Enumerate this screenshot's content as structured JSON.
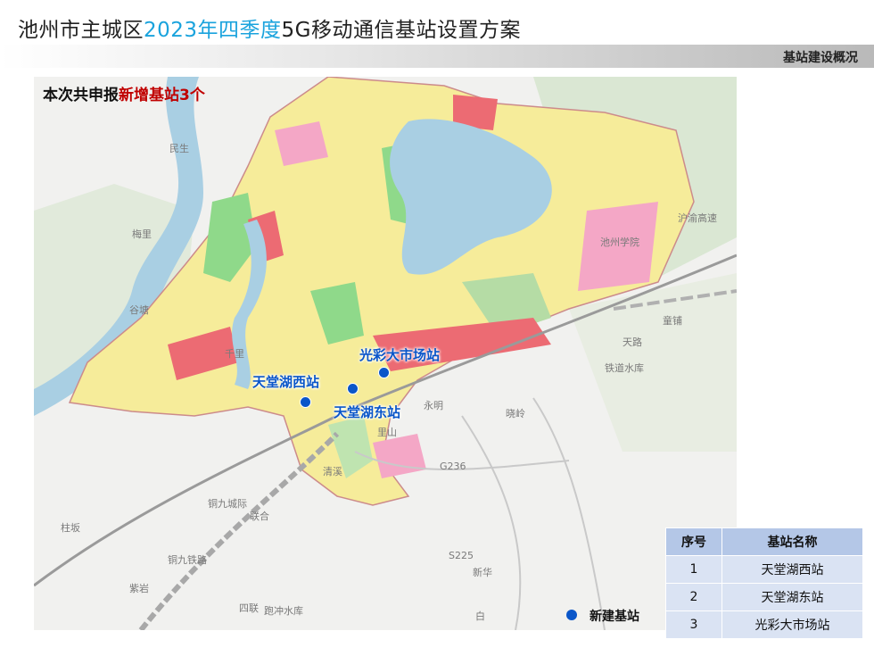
{
  "header": {
    "title_prefix": "池州市主城区",
    "title_highlight": "2023年四季度",
    "title_suffix": "5G移动通信基站设置方案",
    "section": "基站建设概况"
  },
  "summary": {
    "prefix": "本次共申报",
    "highlight": "新增基站3个"
  },
  "stations": [
    {
      "label": "光彩大市场站"
    },
    {
      "label": "天堂湖西站"
    },
    {
      "label": "天堂湖东站"
    }
  ],
  "places": [
    "民生",
    "梅里",
    "谷塘",
    "千里",
    "永明",
    "晓岭",
    "里山",
    "清溪",
    "联合",
    "紫岩",
    "四联",
    "新华",
    "白",
    "柱坂",
    "童铺",
    "天路",
    "池州学院",
    "铁道水库",
    "跑冲水库",
    "沪渝高速",
    "铜九铁路",
    "铜九城际",
    "G236",
    "S225"
  ],
  "legend": {
    "new_station": "新建基站"
  },
  "table": {
    "headers": [
      "序号",
      "基站名称"
    ],
    "rows": [
      [
        "1",
        "天堂湖西站"
      ],
      [
        "2",
        "天堂湖东站"
      ],
      [
        "3",
        "光彩大市场站"
      ]
    ]
  },
  "colors": {
    "station_blue": "#0a56c9",
    "title_highlight": "#1aa3dd",
    "summary_red": "#c00000",
    "table_header": "#b4c7e7",
    "table_row": "#dae3f3"
  }
}
